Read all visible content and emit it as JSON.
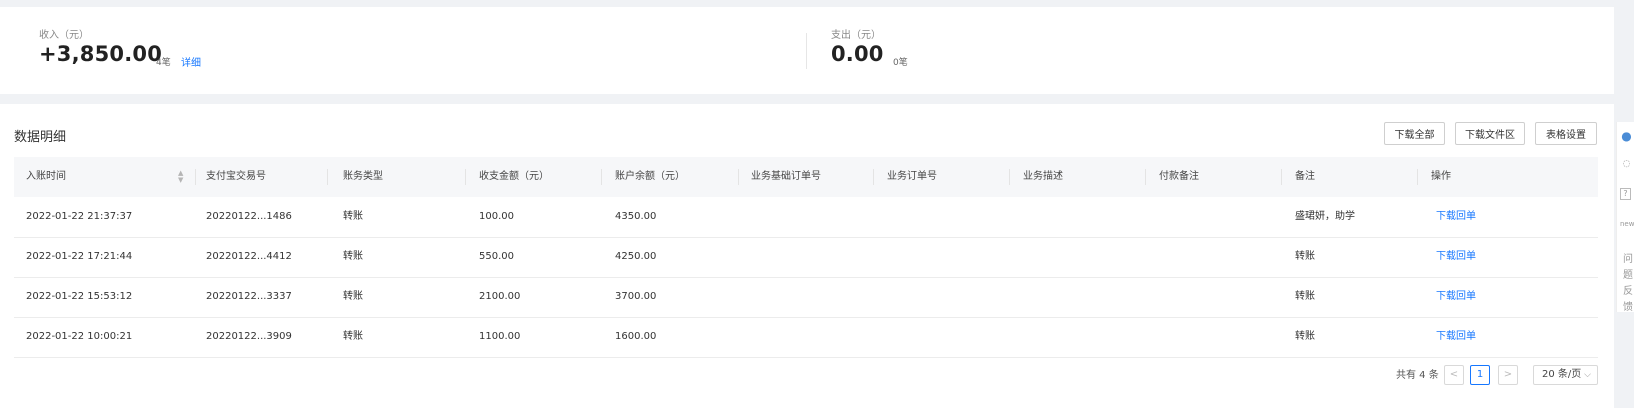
{
  "summary": {
    "income": {
      "label": "收入（元）",
      "amount": "+3,850.00",
      "count": "4笔",
      "detail": "详细"
    },
    "expense": {
      "label": "支出（元）",
      "amount": "0.00",
      "count": "0笔"
    }
  },
  "panel": {
    "title": "数据明细",
    "buttons": {
      "download_all": "下载全部",
      "download_area": "下载文件区",
      "table_settings": "表格设置"
    }
  },
  "table": {
    "headers": [
      "入账时间",
      "支付宝交易号",
      "账务类型",
      "收支金额（元）",
      "账户余额（元）",
      "业务基础订单号",
      "业务订单号",
      "业务描述",
      "付款备注",
      "备注",
      "操作"
    ],
    "rows": [
      {
        "time": "2022-01-22 21:37:37",
        "txn": "20220122...1486",
        "type": "转账",
        "amount": "100.00",
        "balance": "4350.00",
        "note": "盛珺妍，助学",
        "action": "下载回单"
      },
      {
        "time": "2022-01-22 17:21:44",
        "txn": "20220122...4412",
        "type": "转账",
        "amount": "550.00",
        "balance": "4250.00",
        "note": "转账",
        "action": "下载回单"
      },
      {
        "time": "2022-01-22 15:53:12",
        "txn": "20220122...3337",
        "type": "转账",
        "amount": "2100.00",
        "balance": "3700.00",
        "note": "转账",
        "action": "下载回单"
      },
      {
        "time": "2022-01-22 10:00:21",
        "txn": "20220122...3909",
        "type": "转账",
        "amount": "1100.00",
        "balance": "1600.00",
        "note": "转账",
        "action": "下载回单"
      }
    ]
  },
  "pagination": {
    "total": "共有 4 条",
    "current": "1",
    "page_size": "20 条/页"
  },
  "sidebar": {
    "feedback": "问题反馈"
  }
}
